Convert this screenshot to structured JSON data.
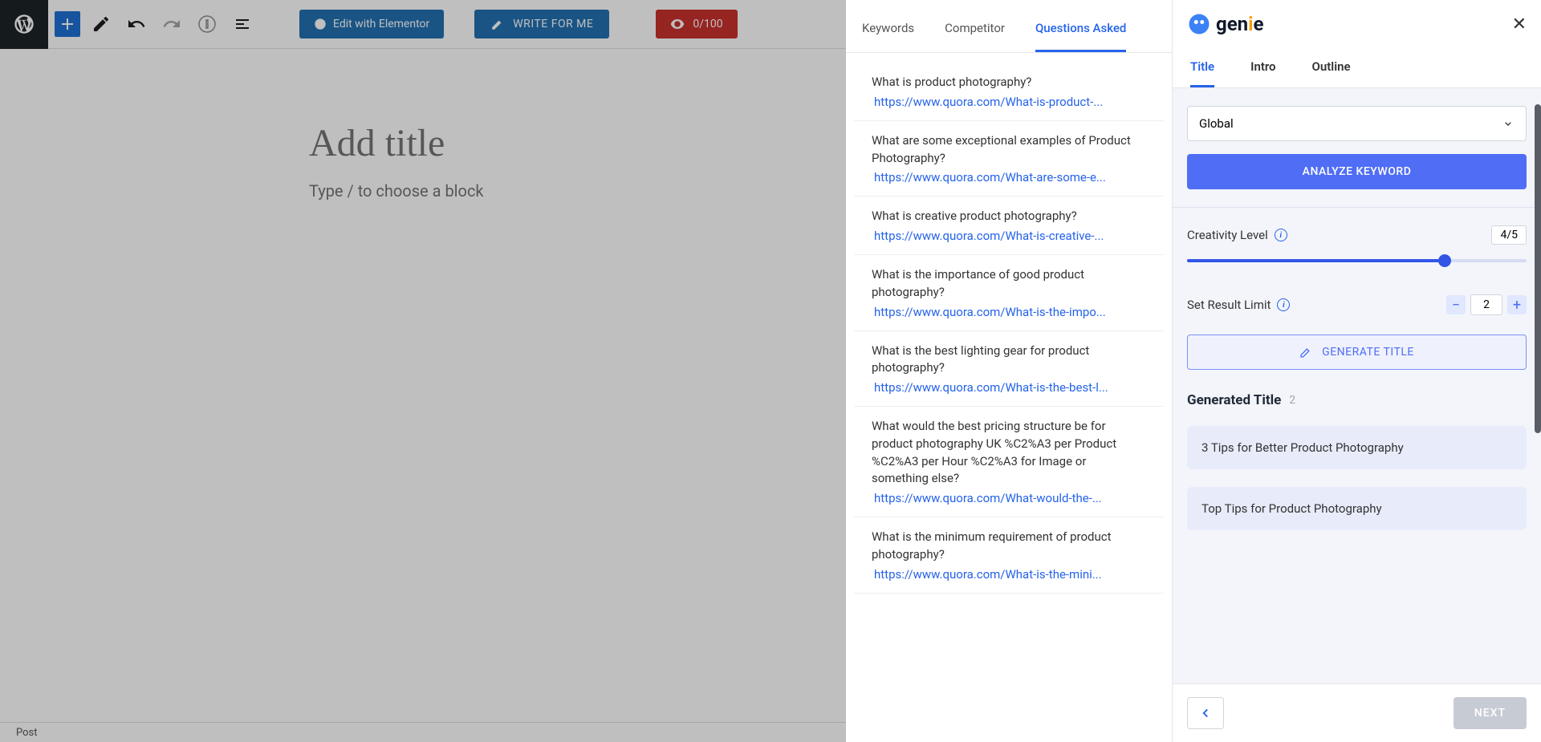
{
  "toolbar": {
    "elementor_label": "Edit with Elementor",
    "write_label": "WRITE FOR ME",
    "score_label": "0/100"
  },
  "editor": {
    "title_placeholder": "Add title",
    "block_hint": "Type / to choose a block"
  },
  "statusbar": {
    "label": "Post"
  },
  "mid_tabs": {
    "keywords": "Keywords",
    "competitor": "Competitor",
    "questions": "Questions Asked"
  },
  "questions": [
    {
      "text": "What is product photography?",
      "url": "https://www.quora.com/What-is-product-..."
    },
    {
      "text": "What are some exceptional examples of Product Photography?",
      "url": "https://www.quora.com/What-are-some-e..."
    },
    {
      "text": "What is creative product photography?",
      "url": "https://www.quora.com/What-is-creative-..."
    },
    {
      "text": "What is the importance of good product photography?",
      "url": "https://www.quora.com/What-is-the-impo..."
    },
    {
      "text": "What is the best lighting gear for product photography?",
      "url": "https://www.quora.com/What-is-the-best-l..."
    },
    {
      "text": "What would the best pricing structure be for product photography UK %C2%A3 per Product %C2%A3 per Hour %C2%A3 for Image or something else?",
      "url": "https://www.quora.com/What-would-the-..."
    },
    {
      "text": "What is the minimum requirement of product photography?",
      "url": "https://www.quora.com/What-is-the-mini..."
    }
  ],
  "genie": {
    "brand": "genie",
    "close": "✕",
    "tabs": {
      "title": "Title",
      "intro": "Intro",
      "outline": "Outline"
    },
    "region_select": "Global",
    "analyze_btn": "ANALYZE KEYWORD",
    "creativity_label": "Creativity Level",
    "creativity_value": "4/5",
    "limit_label": "Set Result Limit",
    "limit_value": "2",
    "generate_btn": "GENERATE TITLE",
    "generated_heading": "Generated Title",
    "generated_count": "2",
    "results": [
      "3 Tips for Better Product Photography",
      "Top Tips for Product Photography"
    ],
    "next_btn": "NEXT"
  }
}
